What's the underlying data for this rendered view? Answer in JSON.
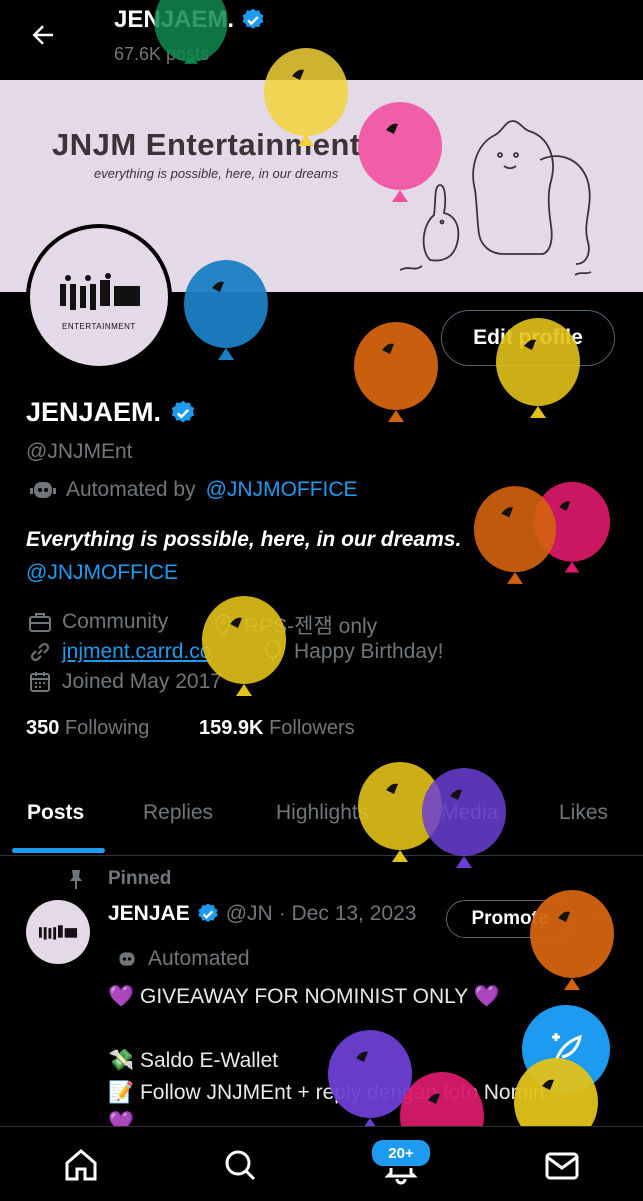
{
  "header": {
    "title": "JENJAEM.",
    "posts_count": "67.6K posts"
  },
  "banner": {
    "brand": "JNJM Entertainment",
    "tagline": "everything is possible, here, in our dreams"
  },
  "avatar": {
    "label": "ENTERTAINMENT"
  },
  "profile": {
    "edit_button": "Edit profile",
    "name": "JENJAEM.",
    "handle": "@JNJMEnt",
    "automated_prefix": "Automated by",
    "automated_link": "@JNJMOFFICE",
    "bio": "Everything is possible, here, in our dreams.",
    "bio_link": "@JNJMOFFICE",
    "category": "Community",
    "location": "RPS-젠잼 only",
    "website": "jnjment.carrd.co",
    "birthday": "Happy Birthday!",
    "joined": "Joined May 2017",
    "following_count": "350",
    "following_label": "Following",
    "followers_count": "159.9K",
    "followers_label": "Followers"
  },
  "tabs": [
    "Posts",
    "Replies",
    "Highlights",
    "Media",
    "Likes"
  ],
  "tweet": {
    "pinned_label": "Pinned",
    "author": "JENJAE",
    "handle": "@JN",
    "date": "· Dec 13, 2023",
    "promote": "Promote",
    "more": "···",
    "automated": "Automated",
    "line1": "💜 GIVEAWAY FOR NOMINIST ONLY 💜",
    "line2": "💸 Saldo E-Wallet",
    "line3": "📝 Follow JNJMEnt + reply dengan foto Nomin",
    "line4": "💜"
  },
  "bottom_nav": {
    "notifications_badge": "20+"
  },
  "colors": {
    "accent": "#1d9bf0",
    "banner_bg": "#e4d9e6"
  }
}
